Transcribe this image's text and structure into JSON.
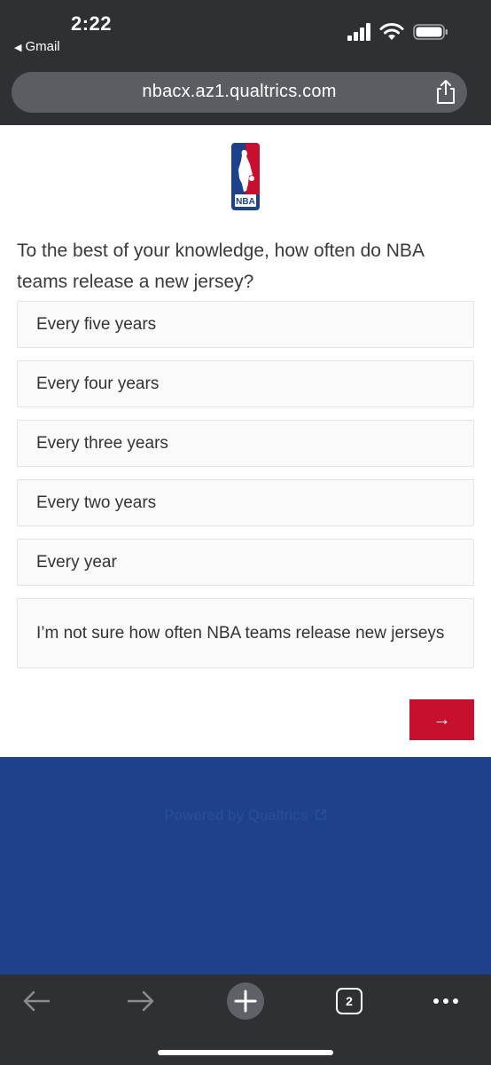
{
  "status_bar": {
    "time": "2:22",
    "back_app": "Gmail"
  },
  "url_bar": {
    "url": "nbacx.az1.qualtrics.com",
    "share_icon": "share-icon"
  },
  "logo": {
    "text": "NBA",
    "colors": {
      "blue": "#1d428a",
      "red": "#c8102e"
    }
  },
  "question": {
    "text": "To the best of your knowledge, how often do NBA teams release a new jersey?",
    "options": [
      "Every five years",
      "Every four years",
      "Every three years",
      "Every two years",
      "Every year",
      "I’m not sure how often NBA teams release new jerseys"
    ]
  },
  "next_button": {
    "label": "→",
    "color": "#c8102e"
  },
  "footer": {
    "powered_by": "Powered by Qualtrics",
    "color": "#1d428a"
  },
  "toolbar": {
    "tab_count": "2",
    "icons": [
      "back-arrow-icon",
      "forward-arrow-icon",
      "new-tab-plus-icon",
      "tab-switcher-icon",
      "more-menu-icon"
    ]
  }
}
